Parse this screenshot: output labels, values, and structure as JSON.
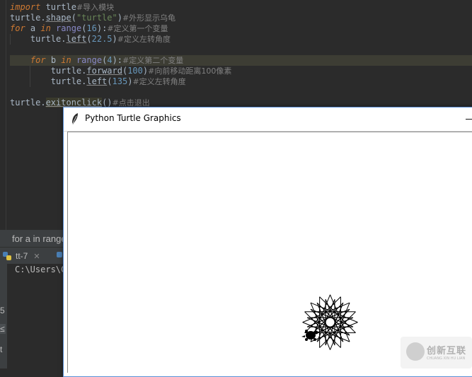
{
  "editor": {
    "lines": [
      {
        "kw": "import",
        "rest": " turtle",
        "comment": "#导入模块"
      },
      {
        "obj": "turtle.",
        "method": "shape",
        "paren_open": "(",
        "str": "\"turtle\"",
        "paren_close": ")",
        "comment": "#外形显示乌龟"
      },
      {
        "kw": "for",
        "a": " a ",
        "kw_in": "in",
        "fn": " range",
        "paren_open": "(",
        "num": "16",
        "paren_close": "):",
        "comment": "#定义第一个变量"
      },
      {
        "indent": "    ",
        "obj": "turtle.",
        "method": "left",
        "paren_open": "(",
        "num": "22.5",
        "paren_close": ")",
        "comment": "#定义左转角度"
      },
      {
        "indent": "    ",
        "kw": "for",
        "a": " b ",
        "kw_in": "in",
        "fn": " range",
        "paren_open": "(",
        "num": "4",
        "paren_close": "):",
        "comment": "#定义第二个变量"
      },
      {
        "indent": "        ",
        "obj": "turtle.",
        "method": "forward",
        "paren_open": "(",
        "num": "100",
        "paren_close": ")",
        "comment": "#向前移动距离100像素"
      },
      {
        "indent": "        ",
        "obj": "turtle.",
        "method": "left",
        "paren_open": "(",
        "num": "135",
        "paren_close": ")",
        "comment": "#定义左转角度"
      },
      {
        "obj": "turtle.",
        "method": "exitonclick",
        "paren_open": "()",
        "comment": "#点击退出"
      }
    ]
  },
  "status": {
    "breadcrumb": "for a in range"
  },
  "run_tab": {
    "label": "tt-7",
    "close": "✕"
  },
  "console": {
    "path": "C:\\Users\\C"
  },
  "side_glyphs": [
    "5",
    "≤",
    "t"
  ],
  "turtle_window": {
    "title": "Python Turtle Graphics",
    "minimize": "—"
  },
  "drawing": {
    "repeats": 16,
    "turn_outer_deg": 22.5,
    "inner_steps": 4,
    "step_length": 100,
    "turn_inner_deg": 135
  },
  "watermark": {
    "text": "创新互联",
    "sub": "CHUANG XIN HU LIAN"
  }
}
